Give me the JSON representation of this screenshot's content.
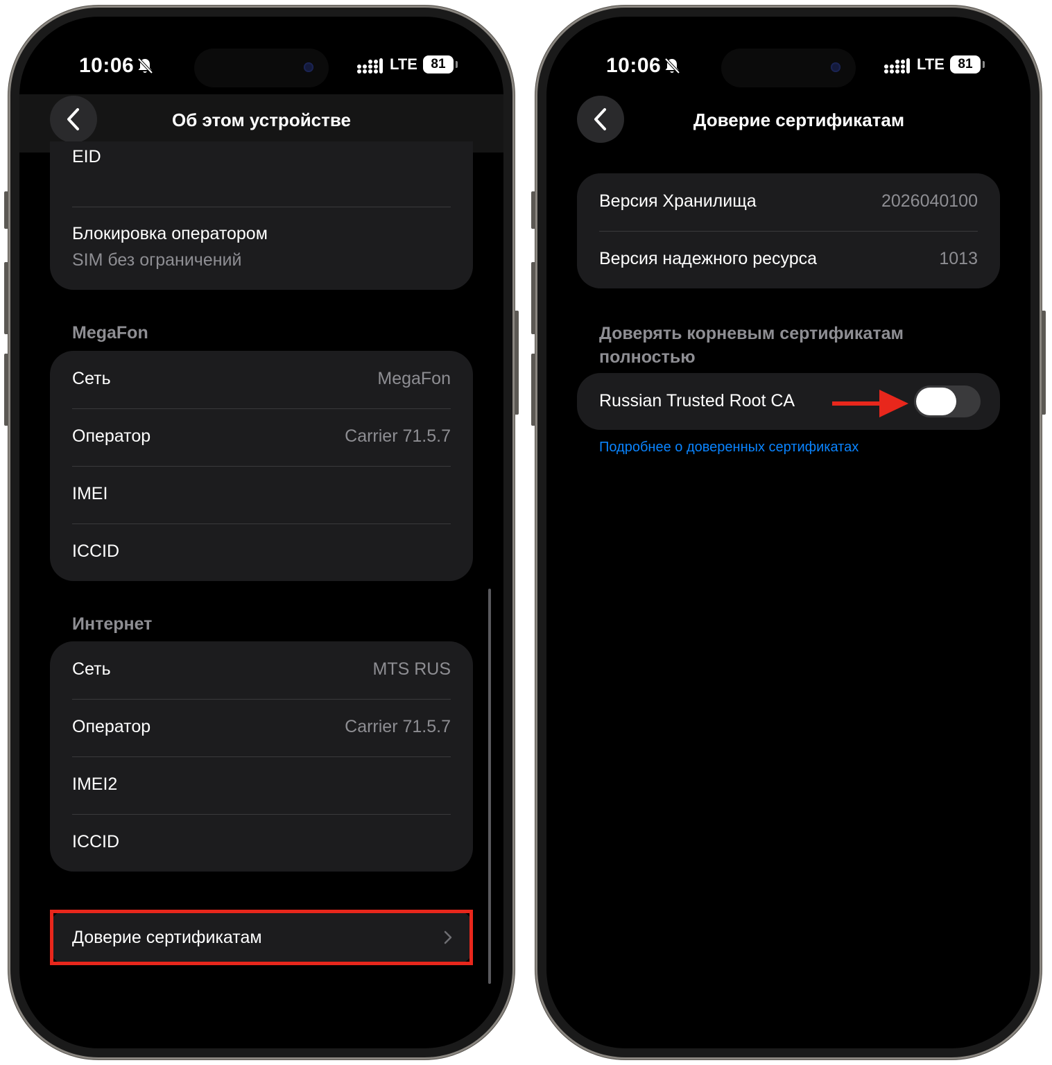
{
  "status_bar": {
    "time": "10:06",
    "network": "LTE",
    "battery": "81"
  },
  "left_screen": {
    "nav_title": "Об этом устройстве",
    "partial_row_label": "EID",
    "lock_row": {
      "title": "Блокировка оператором",
      "subtitle": "SIM без ограничений"
    },
    "megafon_section": {
      "header": "MegaFon",
      "rows": [
        {
          "label": "Сеть",
          "value": "MegaFon"
        },
        {
          "label": "Оператор",
          "value": "Carrier 71.5.7"
        },
        {
          "label": "IMEI",
          "value": ""
        },
        {
          "label": "ICCID",
          "value": ""
        }
      ]
    },
    "internet_section": {
      "header": "Интернет",
      "rows": [
        {
          "label": "Сеть",
          "value": "MTS RUS"
        },
        {
          "label": "Оператор",
          "value": "Carrier 71.5.7"
        },
        {
          "label": "IMEI2",
          "value": ""
        },
        {
          "label": "ICCID",
          "value": ""
        }
      ]
    },
    "cert_trust_row": {
      "label": "Доверие сертификатам",
      "chevron": "chevron-right-icon"
    }
  },
  "right_screen": {
    "nav_title": "Доверие сертификатам",
    "info_rows": [
      {
        "label": "Версия Хранилища",
        "value": "2026040100"
      },
      {
        "label": "Версия надежного ресурса",
        "value": "1013"
      }
    ],
    "trust_section_header": "Доверять корневым сертификатам полностью",
    "trust_row": {
      "label": "Russian Trusted Root CA",
      "toggle_on": false
    },
    "learn_more_link": "Подробнее о доверенных сертификатах"
  },
  "colors": {
    "background": "#000000",
    "cell": "#1c1c1e",
    "secondary_text": "#8e8e93",
    "link": "#0a84ff",
    "annotation": "#e8271c"
  }
}
